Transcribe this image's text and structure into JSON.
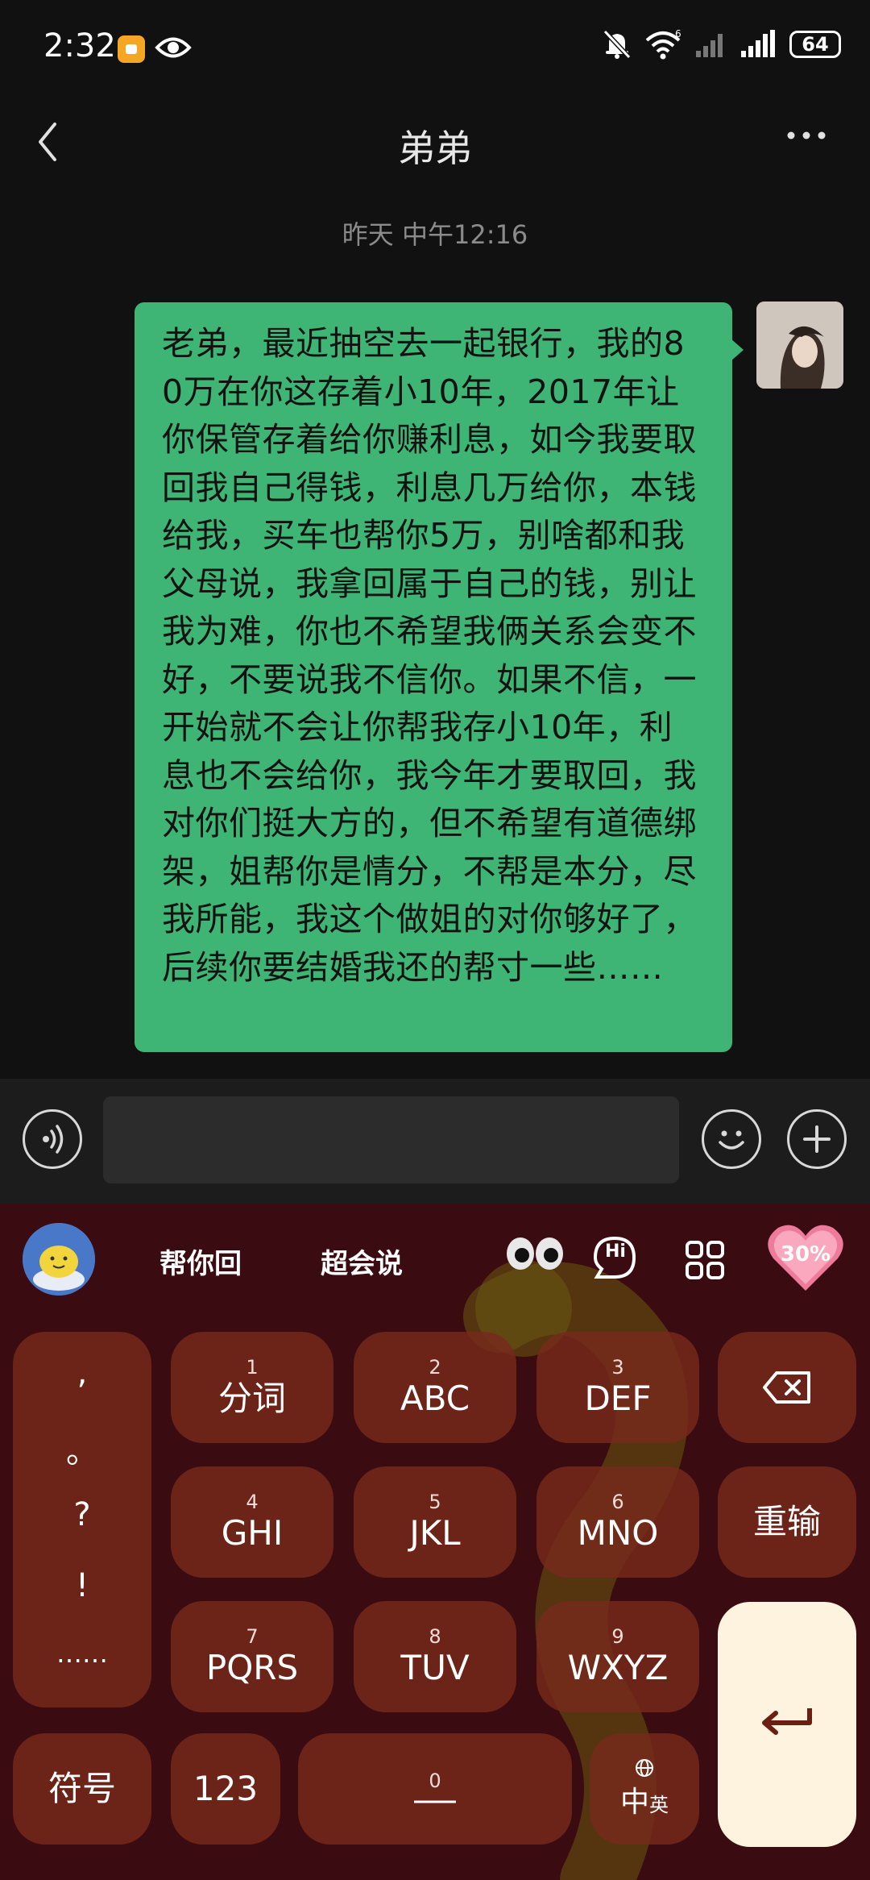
{
  "status_bar": {
    "time": "2:32",
    "battery": "64"
  },
  "header": {
    "title": "弟弟"
  },
  "chat": {
    "timestamp": "昨天 中午12:16",
    "message": "老弟，最近抽空去一起银行，我的80万在你这存着小10年，2017年让你保管存着给你赚利息，如今我要取回我自己得钱，利息几万给你，本钱给我，买车也帮你5万，别啥都和我父母说，我拿回属于自己的钱，别让我为难，你也不希望我俩关系会变不好，不要说我不信你。如果不信，一开始就不会让你帮我存小10年，利息也不会给你，我今年才要取回，我对你们挺大方的，但不希望有道德绑架，姐帮你是情分，不帮是本分，尽我所能，我这个做姐的对你够好了，后续你要结婚我还的帮寸一些……"
  },
  "keyboard": {
    "top": {
      "reply": "帮你回",
      "speak": "超会说",
      "hi": "Hi",
      "heart_percent": "30%"
    },
    "punctuation": [
      ",",
      "。",
      "?",
      "!",
      "……"
    ],
    "keys": [
      {
        "num": "1",
        "label": "分词"
      },
      {
        "num": "2",
        "label": "ABC"
      },
      {
        "num": "3",
        "label": "DEF"
      },
      {
        "num": "4",
        "label": "GHI"
      },
      {
        "num": "5",
        "label": "JKL"
      },
      {
        "num": "6",
        "label": "MNO"
      },
      {
        "num": "7",
        "label": "PQRS"
      },
      {
        "num": "8",
        "label": "TUV"
      },
      {
        "num": "9",
        "label": "WXYZ"
      }
    ],
    "reenter": "重输",
    "symbols": "符号",
    "numbers": "123",
    "space_num": "0",
    "lang_main": "中",
    "lang_sub": "英"
  },
  "colors": {
    "bubble": "#3eb575",
    "keyboard_bg": "#3a0b10",
    "key_bg": "#782a1c",
    "enter_bg": "#fdf3de"
  }
}
